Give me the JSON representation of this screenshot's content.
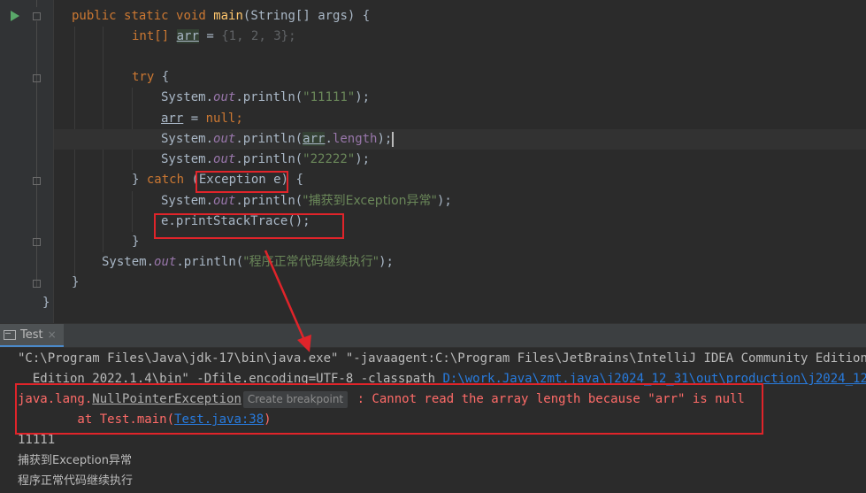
{
  "editor": {
    "main_signature": {
      "public": "public",
      "static": "static",
      "void": "void",
      "name": "main",
      "params": "(String[] args) {"
    },
    "arr_decl": {
      "type": "int[]",
      "var": "arr",
      "eq": " = ",
      "lbrace": "{",
      "n1": "1",
      "n2": "2",
      "n3": "3",
      "tail": "};"
    },
    "try_kw": "try",
    "try_brace": " {",
    "println1": {
      "pre": "System.",
      "out": "out",
      "mid": ".println(",
      "str": "\"11111\"",
      "end": ");"
    },
    "null_assign": {
      "var": "arr",
      "eq": " = ",
      "null": "null",
      "semi": ";"
    },
    "println_length": {
      "pre": "System.",
      "out": "out",
      "mid": ".println(",
      "var": "arr",
      "dot": ".",
      "field": "length",
      "end": ");"
    },
    "println2": {
      "pre": "System.",
      "out": "out",
      "mid": ".println(",
      "str": "\"22222\"",
      "end": ");"
    },
    "catch_line": {
      "close": "} ",
      "kw": "catch",
      "open": " (",
      "params": "Exception e",
      "close_paren": ") {"
    },
    "println_catch": {
      "pre": "System.",
      "out": "out",
      "mid": ".println(",
      "str": "\"捕获到Exception异常\"",
      "end": ");"
    },
    "stacktrace": "e.printStackTrace();",
    "close_brace_inner": "}",
    "println_after": {
      "pre": "System.",
      "out": "out",
      "mid": ".println(",
      "str": "\"程序正常代码继续执行\"",
      "end": ");"
    },
    "close_brace_method": "}",
    "close_brace_class": "}"
  },
  "tool_window": {
    "tab_label": "Test",
    "tab_close": "×"
  },
  "console": {
    "cmd_line": "\"C:\\Program Files\\Java\\jdk-17\\bin\\java.exe\" \"-javaagent:C:\\Program Files\\JetBrains\\IntelliJ IDEA Community Edition",
    "cmd_line2_pre": "  Edition 2022.1.4\\bin\" -Dfile.encoding=UTF-8 -classpath ",
    "cmd_line2_link": "D:\\work.Java\\zmt.java\\j2024_12_31\\out\\production\\j2024_12",
    "exception_prefix": "java.lang.",
    "exception_name": "NullPointerException",
    "create_breakpoint": "Create breakpoint",
    "exception_message": " : Cannot read the array length because \"arr\" is null",
    "stack_prefix": "        at Test.main(",
    "stack_link": "Test.java:38",
    "stack_suffix": ")",
    "out1": "11111",
    "out2": "捕获到Exception异常",
    "out3": "程序正常代码继续执行"
  },
  "colors": {
    "annotation_red": "#e0242a",
    "error_text": "#ff6b68",
    "link": "#287bde"
  }
}
